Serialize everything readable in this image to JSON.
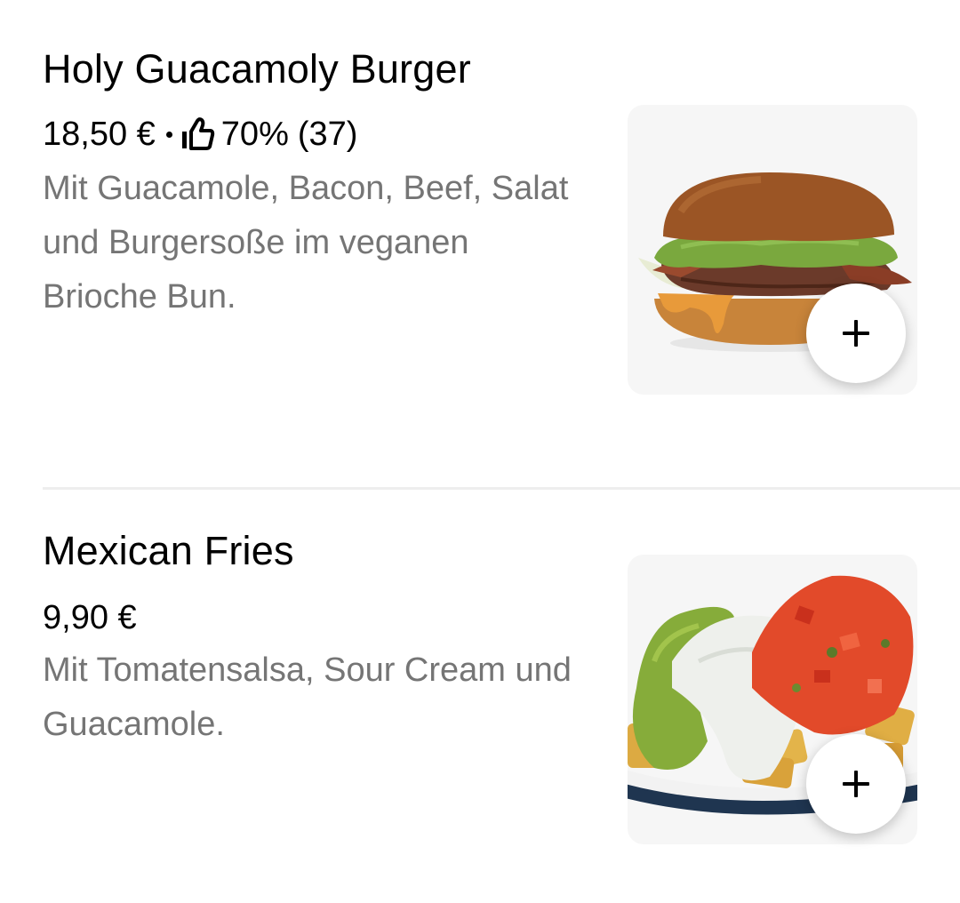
{
  "menu": {
    "items": [
      {
        "title": "Holy Guacamoly Burger",
        "price": "18,50 €",
        "rating_percent": "70%",
        "rating_count": "(37)",
        "description": "Mit Guacamole, Bacon, Beef, Salat und Burgersoße im veganen Brioche Bun.",
        "image_icon": "burger-image",
        "add_icon": "plus-icon"
      },
      {
        "title": "Mexican Fries",
        "price": "9,90 €",
        "description": "Mit Tomatensalsa, Sour Cream und Guacamole.",
        "image_icon": "fries-image",
        "add_icon": "plus-icon"
      }
    ]
  },
  "icons": {
    "rating": "thumbs-up-icon",
    "add": "plus-icon"
  },
  "colors": {
    "text_primary": "#000000",
    "text_secondary": "#757575",
    "image_background": "#f6f6f6",
    "divider": "#eeeeee"
  }
}
